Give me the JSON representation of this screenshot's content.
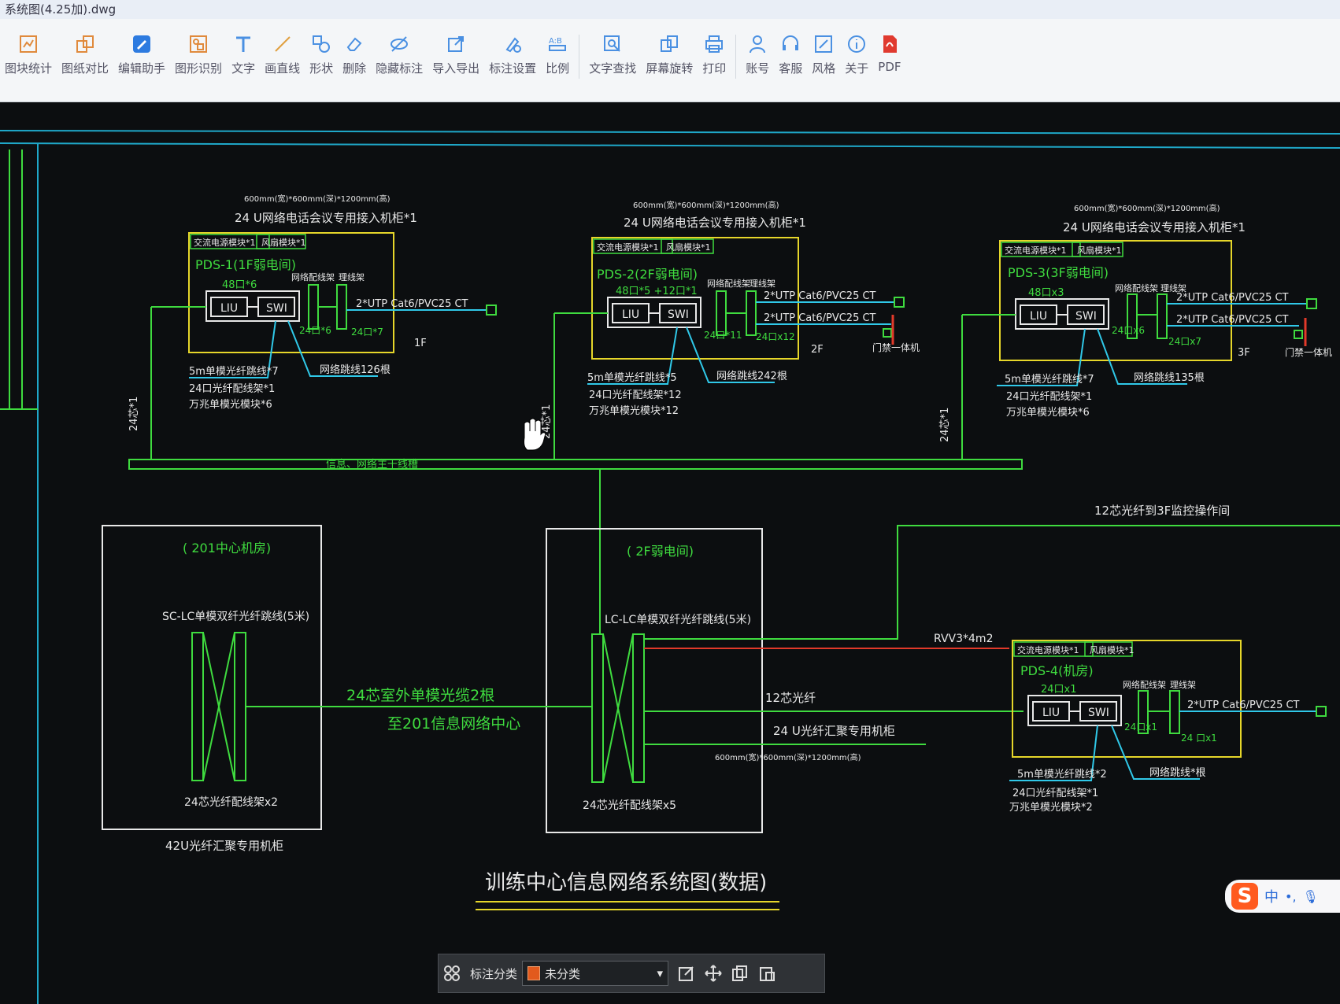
{
  "window": {
    "title": "系统图(4.25加).dwg"
  },
  "toolbar": {
    "items": [
      {
        "label": "图块统计",
        "icon": "block-stats-icon"
      },
      {
        "label": "图纸对比",
        "icon": "compare-icon"
      },
      {
        "label": "编辑助手",
        "icon": "edit-assistant-icon"
      },
      {
        "label": "图形识别",
        "icon": "shape-recognition-icon"
      },
      {
        "label": "文字",
        "icon": "text-icon"
      },
      {
        "label": "画直线",
        "icon": "line-icon"
      },
      {
        "label": "形状",
        "icon": "shape-icon"
      },
      {
        "label": "删除",
        "icon": "eraser-icon"
      },
      {
        "label": "隐藏标注",
        "icon": "hide-icon"
      },
      {
        "label": "导入导出",
        "icon": "import-export-icon"
      },
      {
        "label": "标注设置",
        "icon": "annotation-settings-icon"
      },
      {
        "label": "比例",
        "icon": "scale-icon"
      },
      {
        "label": "文字查找",
        "icon": "text-search-icon"
      },
      {
        "label": "屏幕旋转",
        "icon": "rotate-icon"
      },
      {
        "label": "打印",
        "icon": "print-icon"
      },
      {
        "label": "账号",
        "icon": "account-icon"
      },
      {
        "label": "客服",
        "icon": "headset-icon"
      },
      {
        "label": "风格",
        "icon": "style-icon"
      },
      {
        "label": "关于",
        "icon": "info-icon"
      },
      {
        "label": "PDF",
        "icon": "pdf-icon"
      }
    ]
  },
  "drawing": {
    "title": "训练中心信息网络系统图(数据)",
    "pds1": {
      "cabinet_size": "600mm(宽)*600mm(深)*1200mm(高)",
      "cabinet": "24 U网络电话会议专用接入机柜*1",
      "tag1": "交流电源模块*1",
      "tag2": "风扇模块*1",
      "name": "PDS-1(1F弱电间)",
      "ports": "48口*6",
      "liu": "LIU",
      "swi": "SWI",
      "patch_label": "网络配线架",
      "cable_mgr": "理线架",
      "p1": "24口*6",
      "p2": "24口*7",
      "cable": "2*UTP Cat6/PVC25 CT",
      "floor": "1F",
      "n1": "5m单模光纤跳线*7",
      "n2": "24口光纤配线架*1",
      "n3": "万兆单模光模块*6",
      "n4": "网络跳线126根",
      "vert": "24芯*1"
    },
    "pds2": {
      "cabinet_size": "600mm(宽)*600mm(深)*1200mm(高)",
      "cabinet": "24 U网络电话会议专用接入机柜*1",
      "tag1": "交流电源模块*1",
      "tag2": "风扇模块*1",
      "name": "PDS-2(2F弱电间)",
      "ports": "48口*5 +12口*1",
      "liu": "LIU",
      "swi": "SWI",
      "patch_label": "网络配线架",
      "cable_mgr": "理线架",
      "p1": "24口*11",
      "p2": "24口x12",
      "cable1": "2*UTP Cat6/PVC25 CT",
      "cable2": "2*UTP Cat6/PVC25 CT",
      "floor": "2F",
      "door": "门禁一体机",
      "n1": "5m单模光纤跳线*5",
      "n2": "24口光纤配线架*12",
      "n3": "万兆单模光模块*12",
      "n4": "网络跳线242根",
      "vert": "24芯*1"
    },
    "pds3": {
      "cabinet_size": "600mm(宽)*600mm(深)*1200mm(高)",
      "cabinet": "24 U网络电话会议专用接入机柜*1",
      "tag1": "交流电源模块*1",
      "tag2": "风扇模块*1",
      "name": "PDS-3(3F弱电间)",
      "ports": "48口x3",
      "liu": "LIU",
      "swi": "SWI",
      "patch_label": "网络配线架",
      "cable_mgr": "理线架",
      "p1": "24口x6",
      "p2": "24口x7",
      "cable1": "2*UTP Cat6/PVC25 CT",
      "cable2": "2*UTP Cat6/PVC25 CT",
      "floor": "3F",
      "door": "门禁一体机",
      "n1": "5m单模光纤跳线*7",
      "n2": "24口光纤配线架*1",
      "n3": "万兆单模光模块*6",
      "n4": "网络跳线135根",
      "vert": "24芯*1"
    },
    "pds4": {
      "tag1": "交流电源模块*1",
      "tag2": "风扇模块*1",
      "name": "PDS-4(机房)",
      "ports": "24口x1",
      "liu": "LIU",
      "swi": "SWI",
      "patch_label": "网络配线架",
      "cable_mgr": "理线架",
      "p1": "24口x1",
      "p2": "24 口x1",
      "cable": "2*UTP Cat6/PVC25 CT",
      "n1": "5m单模光纤跳线*2",
      "n2": "24口光纤配线架*1",
      "n3": "万兆单模光模块*2",
      "n4": "网络跳线*根",
      "rvv": "RVV3*4m2"
    },
    "backbone": "信息、网络主干线槽",
    "center201": {
      "title": "( 201中心机房)",
      "sc": "SC-LC单模双纤光纤跳线(5米)",
      "odf": "24芯光纤配线架x2",
      "rack": "42U光纤汇聚专用机柜"
    },
    "room2f": {
      "title": "( 2F弱电间)",
      "lc": "LC-LC单模双纤光纤跳线(5米)",
      "odf": "24芯光纤配线架x5"
    },
    "links": {
      "outdoor1": "24芯室外单模光缆2根",
      "outdoor2": "至201信息网络中心",
      "to3f": "12芯光纤到3F监控操作间",
      "fiber12": "12芯光纤",
      "rack24": "24 U光纤汇聚专用机柜",
      "rack24_size": "600mm(宽)*600mm(深)*1200mm(高)"
    }
  },
  "bottombar": {
    "category_label": "标注分类",
    "category_value": "未分类",
    "category_color": "#e25a1d"
  },
  "ime": {
    "logo": "S",
    "mode": "中"
  }
}
